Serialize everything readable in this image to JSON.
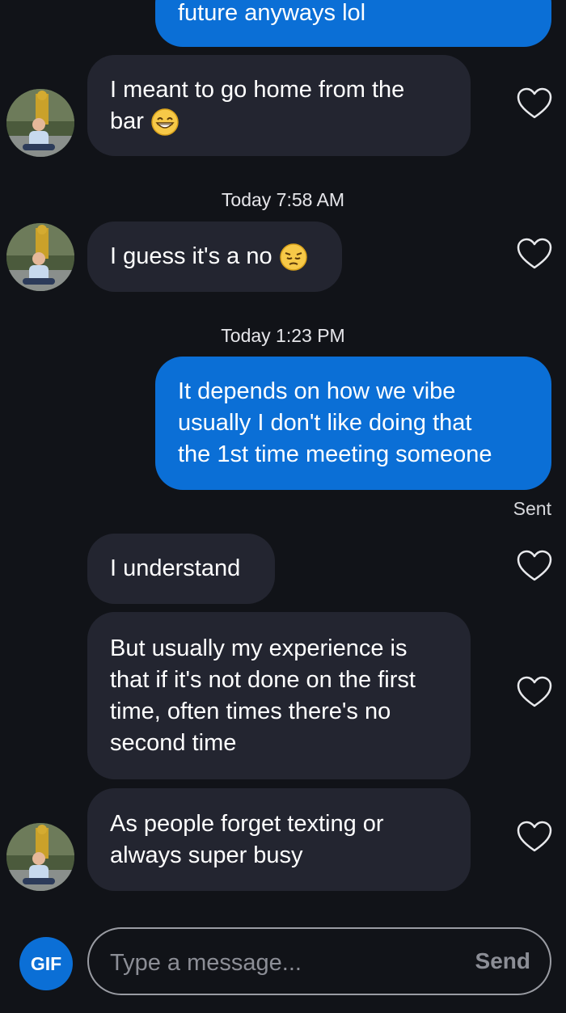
{
  "messages": [
    {
      "id": "m0",
      "direction": "outgoing",
      "lines": [
        "future anyways lol"
      ]
    },
    {
      "id": "m1",
      "direction": "incoming",
      "lines": [
        "I meant to go home from the",
        "bar"
      ],
      "emoji": "grinning-face-emoji"
    },
    {
      "id": "t1",
      "timestamp": "Today 7:58 AM"
    },
    {
      "id": "m2",
      "direction": "incoming",
      "lines": [
        "I guess it's a no"
      ],
      "emoji": "pensive-face-emoji"
    },
    {
      "id": "t2",
      "timestamp": "Today 1:23 PM"
    },
    {
      "id": "m3",
      "direction": "outgoing",
      "lines": [
        "It depends on how we vibe",
        "usually I don't like doing that",
        "the 1st time meeting someone"
      ],
      "status": "Sent"
    },
    {
      "id": "m4",
      "direction": "incoming",
      "lines": [
        "I understand"
      ]
    },
    {
      "id": "m5",
      "direction": "incoming",
      "lines": [
        "But usually my experience is",
        "that if it's not done on the first",
        "time, often times there's no",
        "second time"
      ]
    },
    {
      "id": "m6",
      "direction": "incoming",
      "lines": [
        "As people forget texting or",
        "always super busy"
      ]
    }
  ],
  "composer": {
    "gif_label": "GIF",
    "placeholder": "Type a message...",
    "send_label": "Send"
  },
  "colors": {
    "background": "#111318",
    "incoming_bubble": "#232530",
    "outgoing_bubble": "#0b6fd6"
  }
}
